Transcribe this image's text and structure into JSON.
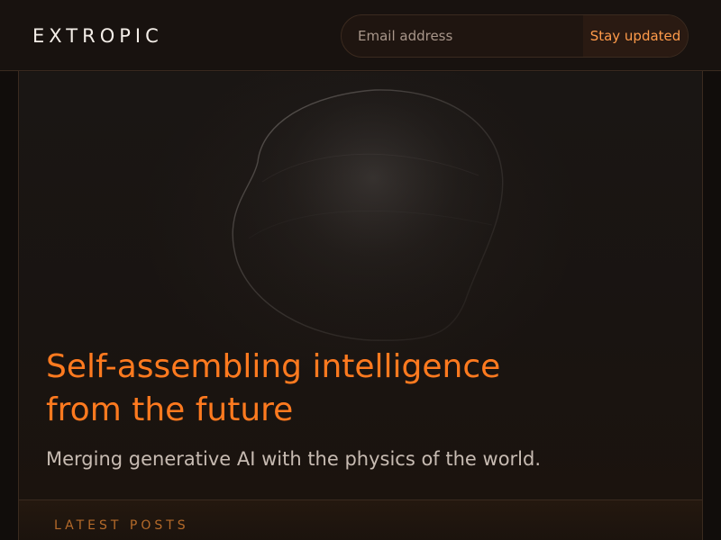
{
  "brand": {
    "logo_text": "EXTROPIC"
  },
  "subscribe": {
    "email_placeholder": "Email address",
    "button_label": "Stay updated"
  },
  "hero": {
    "headline": "Self-assembling intelligence from the future",
    "subheadline": "Merging generative AI with the physics of the world."
  },
  "posts": {
    "section_title": "LATEST POSTS"
  },
  "colors": {
    "accent": "#ff7a1f",
    "button_text": "#ff9b4a",
    "background": "#161210",
    "border": "#3a2a1f"
  }
}
